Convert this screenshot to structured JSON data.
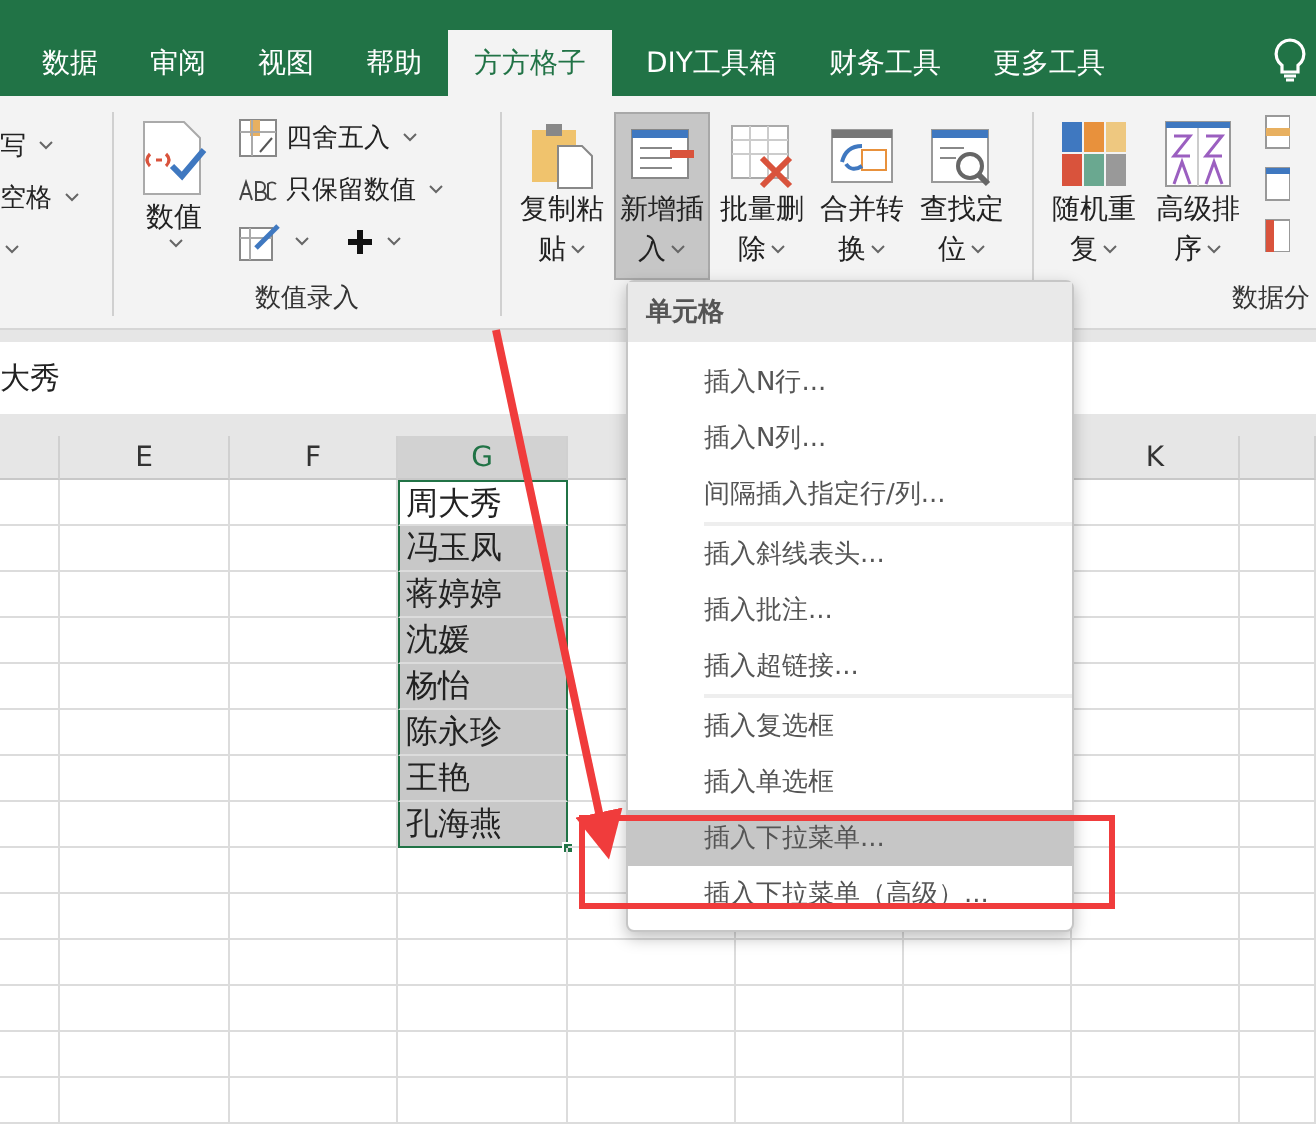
{
  "ribbon_tabs": [
    {
      "label": "数据",
      "selected": false
    },
    {
      "label": "审阅",
      "selected": false
    },
    {
      "label": "视图",
      "selected": false
    },
    {
      "label": "帮助",
      "selected": false
    },
    {
      "label": "方方格子",
      "selected": true
    },
    {
      "label": "DIY工具箱",
      "selected": false
    },
    {
      "label": "财务工具",
      "selected": false
    },
    {
      "label": "更多工具",
      "selected": false
    }
  ],
  "left_group_items": [
    {
      "label": "写"
    },
    {
      "label": "空格"
    }
  ],
  "number_group": {
    "label": "数值录入",
    "big_button": "数值",
    "small_buttons": [
      {
        "label": "四舍五入"
      },
      {
        "label": "只保留数值"
      }
    ]
  },
  "tool_buttons": [
    {
      "label": "复制粘贴",
      "pressed": false
    },
    {
      "label": "新增插入",
      "pressed": true
    },
    {
      "label": "批量删除",
      "pressed": false
    },
    {
      "label": "合并转换",
      "pressed": false
    },
    {
      "label": "查找定位",
      "pressed": false
    }
  ],
  "data_group": {
    "label": "数据分",
    "buttons": [
      {
        "label": "随机重复"
      },
      {
        "label": "高级排序"
      }
    ]
  },
  "formula_bar": {
    "value": "大秀"
  },
  "column_headers": [
    {
      "label": "E",
      "selected": false
    },
    {
      "label": "F",
      "selected": false
    },
    {
      "label": "G",
      "selected": true
    },
    {
      "label": "K",
      "selected": false
    }
  ],
  "g_cells": [
    {
      "text": "周大秀",
      "active": true
    },
    {
      "text": "冯玉凤",
      "active": false
    },
    {
      "text": "蒋婷婷",
      "active": false
    },
    {
      "text": "沈媛",
      "active": false
    },
    {
      "text": "杨怡",
      "active": false
    },
    {
      "text": "陈永珍",
      "active": false
    },
    {
      "text": "王艳",
      "active": false
    },
    {
      "text": "孔海燕",
      "active": false
    }
  ],
  "menu": {
    "header": "单元格",
    "groups": [
      [
        {
          "label": "插入N行...",
          "selected": false
        },
        {
          "label": "插入N列...",
          "selected": false
        },
        {
          "label": "间隔插入指定行/列...",
          "selected": false
        }
      ],
      [
        {
          "label": "插入斜线表头...",
          "selected": false
        },
        {
          "label": "插入批注...",
          "selected": false
        },
        {
          "label": "插入超链接...",
          "selected": false
        }
      ],
      [
        {
          "label": "插入复选框",
          "selected": false
        },
        {
          "label": "插入单选框",
          "selected": false
        },
        {
          "label": "插入下拉菜单...",
          "selected": true
        },
        {
          "label": "插入下拉菜单（高级）...",
          "selected": false
        }
      ]
    ]
  }
}
